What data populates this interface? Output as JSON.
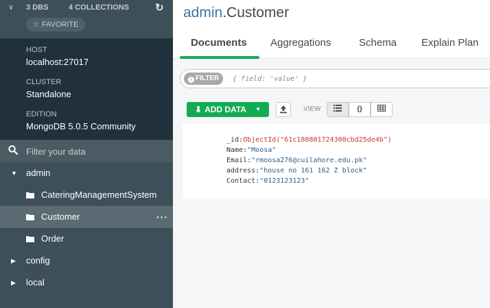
{
  "sidebar": {
    "stats": {
      "dbs_count": "3",
      "dbs_label": "DBS",
      "collections_count": "4",
      "collections_label": "COLLECTIONS"
    },
    "favorite_label": "FAVORITE",
    "host_label": "HOST",
    "host_value": "localhost:27017",
    "cluster_label": "CLUSTER",
    "cluster_value": "Standalone",
    "edition_label": "EDITION",
    "edition_value": "MongoDB 5.0.5 Community",
    "filter_placeholder": "Filter your data",
    "databases": [
      {
        "name": "admin",
        "expanded": true,
        "collections": [
          "CateringManagementSystem",
          "Customer",
          "Order"
        ]
      },
      {
        "name": "config",
        "expanded": false
      },
      {
        "name": "local",
        "expanded": false
      }
    ],
    "active_collection": "Customer"
  },
  "main": {
    "title_db": "admin",
    "title_sep": ".",
    "title_collection": "Customer",
    "tabs": [
      {
        "label": "Documents",
        "active": true
      },
      {
        "label": "Aggregations",
        "active": false
      },
      {
        "label": "Schema",
        "active": false
      },
      {
        "label": "Explain Plan",
        "active": false
      }
    ],
    "filter_pill": "FILTER",
    "filter_placeholder": "{ field: 'value' }",
    "add_data_label": "ADD DATA",
    "view_label": "VIEW",
    "document": {
      "fields": [
        {
          "key": "_id:",
          "value": "ObjectId(\"61c180801724300cbd25de4b\")",
          "kind": "oid"
        },
        {
          "key": "Name:",
          "value": "\"Moosa\"",
          "kind": "str"
        },
        {
          "key": "Email:",
          "value": "\"rmoosa276@cuilahore.edu.pk\"",
          "kind": "str"
        },
        {
          "key": "address:",
          "value": "\"house no 161 162 Z block\"",
          "kind": "str"
        },
        {
          "key": "Contact:",
          "value": "\"0123123123\"",
          "kind": "str"
        }
      ]
    }
  },
  "colors": {
    "accent": "#13aa52",
    "sidebar_bg": "#3d4f58",
    "sidebar_dark": "#21313c",
    "link_blue": "#3b76a8"
  }
}
